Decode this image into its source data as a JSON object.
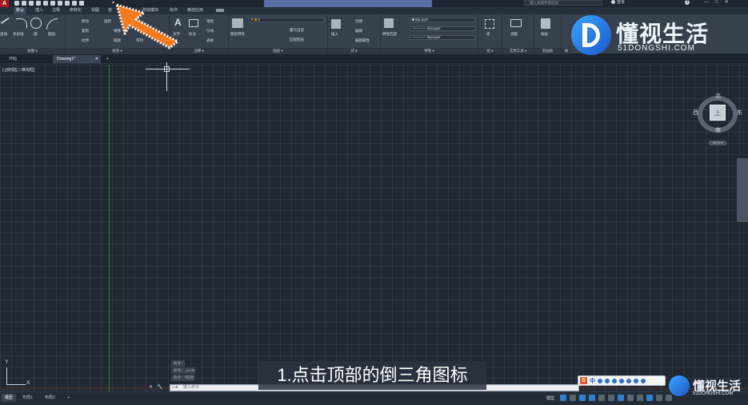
{
  "app": {
    "logo_letter": "A"
  },
  "title_bar": {
    "search_placeholder": "键入关键字或短语",
    "login_label": "登录",
    "help_label": "?",
    "window_controls": [
      "—",
      "□",
      "✕"
    ]
  },
  "ribbon_tabs": [
    "默认",
    "插入",
    "注释",
    "参数化",
    "视图",
    "管",
    "附加模块",
    "协作",
    "精选应用"
  ],
  "panels": {
    "draw": {
      "title": "绘图 ▾",
      "tools": [
        "直线",
        "多段线",
        "圆",
        "圆弧"
      ]
    },
    "modify": {
      "title": "修改 ▾",
      "tools": [
        "移动",
        "旋转",
        "复制",
        "镜像",
        "拉伸",
        "缩放",
        "阵列"
      ]
    },
    "annotation": {
      "title": "注释 ▾",
      "tools": [
        "文字",
        "标注",
        "线性",
        "引线",
        "表格"
      ]
    },
    "layers": {
      "title": "图层 ▾",
      "tools": [
        "图层特性",
        "置为当前",
        "匹配图层"
      ],
      "current_layer": "0"
    },
    "block": {
      "title": "块 ▾",
      "tools": [
        "插入",
        "创建",
        "编辑",
        "编辑属性"
      ]
    },
    "properties": {
      "title": "特性 ▾",
      "tools": [
        "特性匹配"
      ],
      "color": "ByLayer",
      "linetype": "ByLayer",
      "lineweight": "ByLayer"
    },
    "groups": {
      "title": "组 ▾",
      "tools": [
        "组"
      ]
    },
    "utilities": {
      "title": "实用工具 ▾",
      "tools": [
        "测量"
      ]
    },
    "clipboard": {
      "title": "剪贴板",
      "tools": [
        "粘贴"
      ]
    },
    "view": {
      "title": "视"
    }
  },
  "file_tabs": {
    "start": "开始",
    "drawing": "Drawing1*",
    "close": "✕",
    "add": "+"
  },
  "viewport": {
    "label": "[-][俯视][二维线框]"
  },
  "viewcube": {
    "face": "上",
    "north": "北",
    "south": "南",
    "east": "东",
    "west": "西",
    "wcs": "WCS ▾"
  },
  "ucs": {
    "x": "X",
    "y": "Y"
  },
  "command": {
    "history": [
      "命令：",
      "命令：_circle",
      "命令：*取消*"
    ],
    "placeholder": "键入命令",
    "left_icons": [
      "✕",
      "🔧",
      "▭▾"
    ]
  },
  "subtitle": "1.点击顶部的倒三角图标",
  "status_tabs": [
    "模型",
    "布局1",
    "布局2",
    "+"
  ],
  "status_model": "模型",
  "ime": {
    "s": "S",
    "zh": "中"
  },
  "watermark": {
    "title": "懂视生活",
    "subtitle": "51DONGSHI.COM"
  },
  "colors": {
    "accent_arrow": "#f57b1f",
    "ribbon_bg": "#37404d",
    "canvas_bg": "#212831",
    "logo_red": "#a31b1b"
  }
}
